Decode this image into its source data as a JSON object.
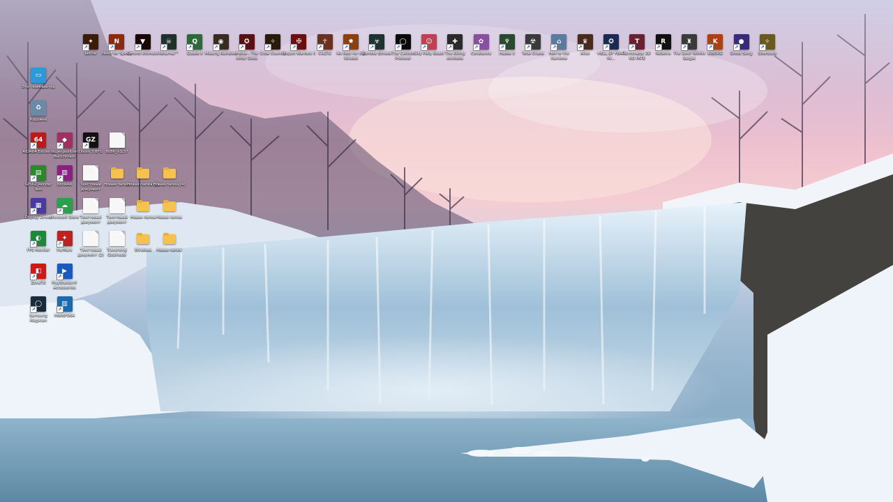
{
  "desktop": {
    "top_row": [
      {
        "label": "Lethal",
        "icon": "fire-game-icon",
        "color": "#3a1c08",
        "glyph": "✦"
      },
      {
        "label": "Need for Speed",
        "icon": "nfs-game-icon",
        "color": "#8a2a10",
        "glyph": "N"
      },
      {
        "label": "Control Ultimate",
        "icon": "control-game-icon",
        "color": "#1a0808",
        "glyph": "▼"
      },
      {
        "label": "Returnal™",
        "icon": "returnal-game-icon",
        "color": "#20302a",
        "glyph": "☠"
      },
      {
        "label": "Quake II",
        "icon": "quake-game-icon",
        "color": "#2d6a3a",
        "glyph": "Q"
      },
      {
        "label": "Missing Rainbow",
        "icon": "missing-game-icon",
        "color": "#3a2b20",
        "glyph": "◉"
      },
      {
        "label": "Indika - The other Gods",
        "icon": "indika-game-icon",
        "color": "#5a1010",
        "glyph": "✪"
      },
      {
        "label": "Crow Country",
        "icon": "crow-game-icon",
        "color": "#2a1a0a",
        "glyph": "✧"
      },
      {
        "label": "Project Warlock II",
        "icon": "warlock-game-icon",
        "color": "#6a0e0e",
        "glyph": "✠"
      },
      {
        "label": "CULTIC",
        "icon": "cultic-game-icon",
        "color": "#6a3020",
        "glyph": "☥"
      },
      {
        "label": "No Rest for the Wicked",
        "icon": "norest-game-icon",
        "color": "#8a4010",
        "glyph": "✹"
      },
      {
        "label": "Zombie Echoes",
        "icon": "zombie-game-icon",
        "color": "#1e3232",
        "glyph": "☣"
      },
      {
        "label": "The Callisto Protocol",
        "icon": "callisto-game-icon",
        "color": "#0a0a0a",
        "glyph": "◯"
      },
      {
        "label": "Silly Polly Beast",
        "icon": "polly-game-icon",
        "color": "#c04050",
        "glyph": "☺"
      },
      {
        "label": "The Killing Antidote",
        "icon": "antidote-game-icon",
        "color": "#2a2a2a",
        "glyph": "✚"
      },
      {
        "label": "Constance",
        "icon": "constance-game-icon",
        "color": "#8a50a0",
        "glyph": "✿"
      },
      {
        "label": "Hades II",
        "icon": "hades-game-icon",
        "color": "#2a4a30",
        "glyph": "♆"
      },
      {
        "label": "Total Chaos",
        "icon": "chaos-game-icon",
        "color": "#3a3a3a",
        "glyph": "☢"
      },
      {
        "label": "Hell to the Rainbow",
        "icon": "rainbow-game-icon",
        "color": "#5a7aa0",
        "glyph": "⌂"
      },
      {
        "label": "Alice",
        "icon": "alice-game-icon",
        "color": "#4a2a1a",
        "glyph": "♛"
      },
      {
        "label": "HELL OF FEAR Mi...",
        "icon": "hellfear-game-icon",
        "color": "#1a2a50",
        "glyph": "✪"
      },
      {
        "label": "Terminator 2D NO FATE",
        "icon": "terminator-game-icon",
        "color": "#6a2030",
        "glyph": "T"
      },
      {
        "label": "ReSetra",
        "icon": "resetra-game-icon",
        "color": "#111111",
        "glyph": "R"
      },
      {
        "label": "The Devil Within Satgat",
        "icon": "devil-game-icon",
        "color": "#3a3a3a",
        "glyph": "♜"
      },
      {
        "label": "KIBORG",
        "icon": "kiborg-game-icon",
        "color": "#b04010",
        "glyph": "K"
      },
      {
        "label": "Ghost Song",
        "icon": "ghostsong-game-icon",
        "color": "#3a2a7a",
        "glyph": "●"
      },
      {
        "label": "Shortcuts",
        "icon": "shortcut-star-icon",
        "color": "#6a5a20",
        "glyph": "✧"
      }
    ],
    "left_icons": [
      {
        "label": "Этот компьютер",
        "icon": "computer-icon",
        "kind": "app",
        "color": "#2a9ad8",
        "glyph": "▭"
      },
      {
        "label": "Корзина",
        "icon": "recycle-bin-icon",
        "kind": "app",
        "color": "#6a8aa8",
        "glyph": "♻"
      },
      {
        "label": "AIDA64 Extreme",
        "icon": "aida64-icon",
        "kind": "app",
        "color": "#c01818",
        "glyph": "64"
      },
      {
        "label": "Superposition Benchmark",
        "icon": "superposition-icon",
        "kind": "app",
        "color": "#a03060",
        "glyph": "◆"
      },
      {
        "label": "Doom 3 BFG",
        "icon": "gz-doom-icon",
        "kind": "app",
        "color": "#111111",
        "glyph": "GZ"
      },
      {
        "label": "8086_v1.37",
        "icon": "text-file-icon",
        "kind": "doc",
        "color": "#f7f7f7",
        "glyph": ""
      },
      {
        "label": "GPU-Z Render Test",
        "icon": "gpuz-icon",
        "kind": "app",
        "color": "#2a8a2a",
        "glyph": "▤"
      },
      {
        "label": "WinRAR",
        "icon": "winrar-icon",
        "kind": "app",
        "color": "#8a2080",
        "glyph": "▥"
      },
      {
        "label": "Текстовый документ",
        "icon": "text-document-icon",
        "kind": "doc",
        "color": "#f7f7f7",
        "glyph": ""
      },
      {
        "label": "Новая папка",
        "icon": "folder-icon",
        "kind": "folder",
        "color": "#f5c24e",
        "glyph": ""
      },
      {
        "label": "Новая папка (2)",
        "icon": "folder-icon",
        "kind": "folder",
        "color": "#f5c24e",
        "glyph": ""
      },
      {
        "label": "Новая папка (4)",
        "icon": "folder-icon",
        "kind": "folder",
        "color": "#f5c24e",
        "glyph": ""
      },
      {
        "label": "Display Driver",
        "icon": "display-driver-icon",
        "kind": "app",
        "color": "#4a3aa0",
        "glyph": "▦"
      },
      {
        "label": "Microsoft Store",
        "icon": "chat-bubble-icon",
        "kind": "app",
        "color": "#2aa04a",
        "glyph": "☁"
      },
      {
        "label": "Текстовый документ",
        "icon": "text-document-icon",
        "kind": "doc",
        "color": "#f7f7f7",
        "glyph": ""
      },
      {
        "label": "Текстовый документ",
        "icon": "text-document-icon",
        "kind": "doc",
        "color": "#f7f7f7",
        "glyph": ""
      },
      {
        "label": "Новая папка",
        "icon": "folder-icon",
        "kind": "folder",
        "color": "#f5c24e",
        "glyph": ""
      },
      {
        "label": "Новая папка",
        "icon": "folder-icon",
        "kind": "folder",
        "color": "#f5c24e",
        "glyph": ""
      },
      {
        "label": "FPS Monitor",
        "icon": "fps-monitor-icon",
        "kind": "app",
        "color": "#1a8a3a",
        "glyph": "◐"
      },
      {
        "label": "FurMark",
        "icon": "furmark-icon",
        "kind": "app",
        "color": "#c02020",
        "glyph": "✦"
      },
      {
        "label": "Текстовый документ (2)",
        "icon": "text-document-icon",
        "kind": "doc",
        "color": "#f7f7f7",
        "glyph": ""
      },
      {
        "label": "Traversing Godmode",
        "icon": "godmode-file-icon",
        "kind": "doc",
        "color": "#f7f7f7",
        "glyph": ""
      },
      {
        "label": "Windows",
        "icon": "folder-icon",
        "kind": "folder",
        "color": "#f5c24e",
        "glyph": ""
      },
      {
        "label": "Новая папка",
        "icon": "folder-icon",
        "kind": "folder",
        "color": "#f5c24e",
        "glyph": ""
      },
      {
        "label": "ZoneTK",
        "icon": "zone-tk-icon",
        "kind": "app",
        "color": "#d01818",
        "glyph": "◧"
      },
      {
        "label": "PlayStation® Accessories",
        "icon": "playstation-icon",
        "kind": "app",
        "color": "#1a5ac0",
        "glyph": "▶"
      },
      {
        "label": "Samsung Magician",
        "icon": "samsung-magician-icon",
        "kind": "app",
        "color": "#1a2a3a",
        "glyph": "◯"
      },
      {
        "label": "HWiNFO64",
        "icon": "hwinfo-icon",
        "kind": "app",
        "color": "#1a6ab0",
        "glyph": "▥"
      }
    ]
  }
}
